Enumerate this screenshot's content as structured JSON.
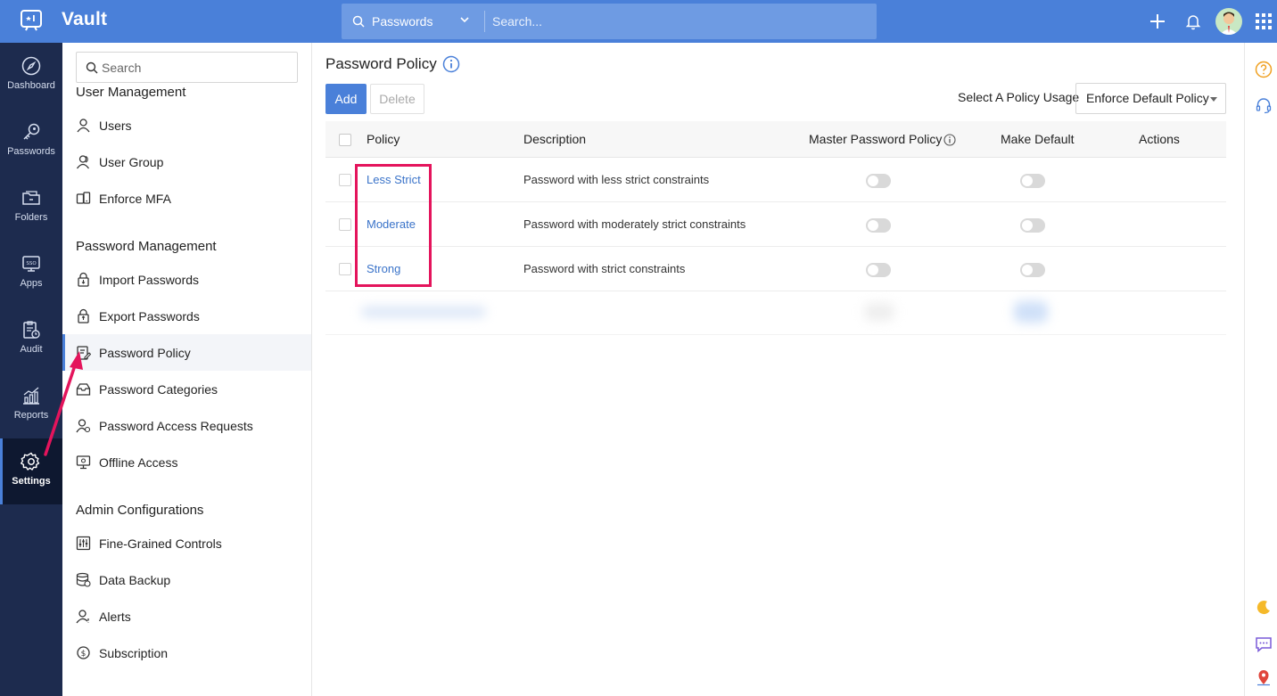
{
  "app": {
    "title": "Vault"
  },
  "search": {
    "scope": "Passwords",
    "placeholder": "Search..."
  },
  "rail": {
    "items": [
      {
        "label": "Dashboard",
        "icon": "compass-icon"
      },
      {
        "label": "Passwords",
        "icon": "key-icon"
      },
      {
        "label": "Folders",
        "icon": "folder-icon"
      },
      {
        "label": "Apps",
        "icon": "sso-apps-icon"
      },
      {
        "label": "Audit",
        "icon": "audit-clipboard-icon"
      },
      {
        "label": "Reports",
        "icon": "reports-chart-icon"
      },
      {
        "label": "Settings",
        "icon": "gear-icon",
        "active": true
      }
    ]
  },
  "subpanel": {
    "search_placeholder": "Search",
    "sections": [
      {
        "heading": "User Management",
        "items": [
          "Users",
          "User Group",
          "Enforce MFA"
        ]
      },
      {
        "heading": "Password Management",
        "items": [
          "Import Passwords",
          "Export Passwords",
          "Password Policy",
          "Password Categories",
          "Password Access Requests",
          "Offline Access"
        ]
      },
      {
        "heading": "Admin Configurations",
        "items": [
          "Fine-Grained Controls",
          "Data Backup",
          "Alerts",
          "Subscription"
        ]
      }
    ],
    "active_item": "Password Policy"
  },
  "main": {
    "title": "Password Policy",
    "add_label": "Add",
    "delete_label": "Delete",
    "usage_label": "Select A Policy Usage",
    "usage_value": "Enforce Default Policy",
    "columns": {
      "policy": "Policy",
      "description": "Description",
      "master": "Master Password Policy",
      "default": "Make Default",
      "actions": "Actions"
    },
    "rows": [
      {
        "policy": "Less Strict",
        "description": "Password with less strict constraints",
        "master": false,
        "default": false
      },
      {
        "policy": "Moderate",
        "description": "Password with moderately strict constraints",
        "master": false,
        "default": false
      },
      {
        "policy": "Strong",
        "description": "Password with strict constraints",
        "master": false,
        "default": false
      }
    ]
  },
  "colors": {
    "accent": "#4a80d9",
    "rail": "#1d2b4e",
    "highlight": "#e4145c",
    "link": "#3a73c9"
  }
}
